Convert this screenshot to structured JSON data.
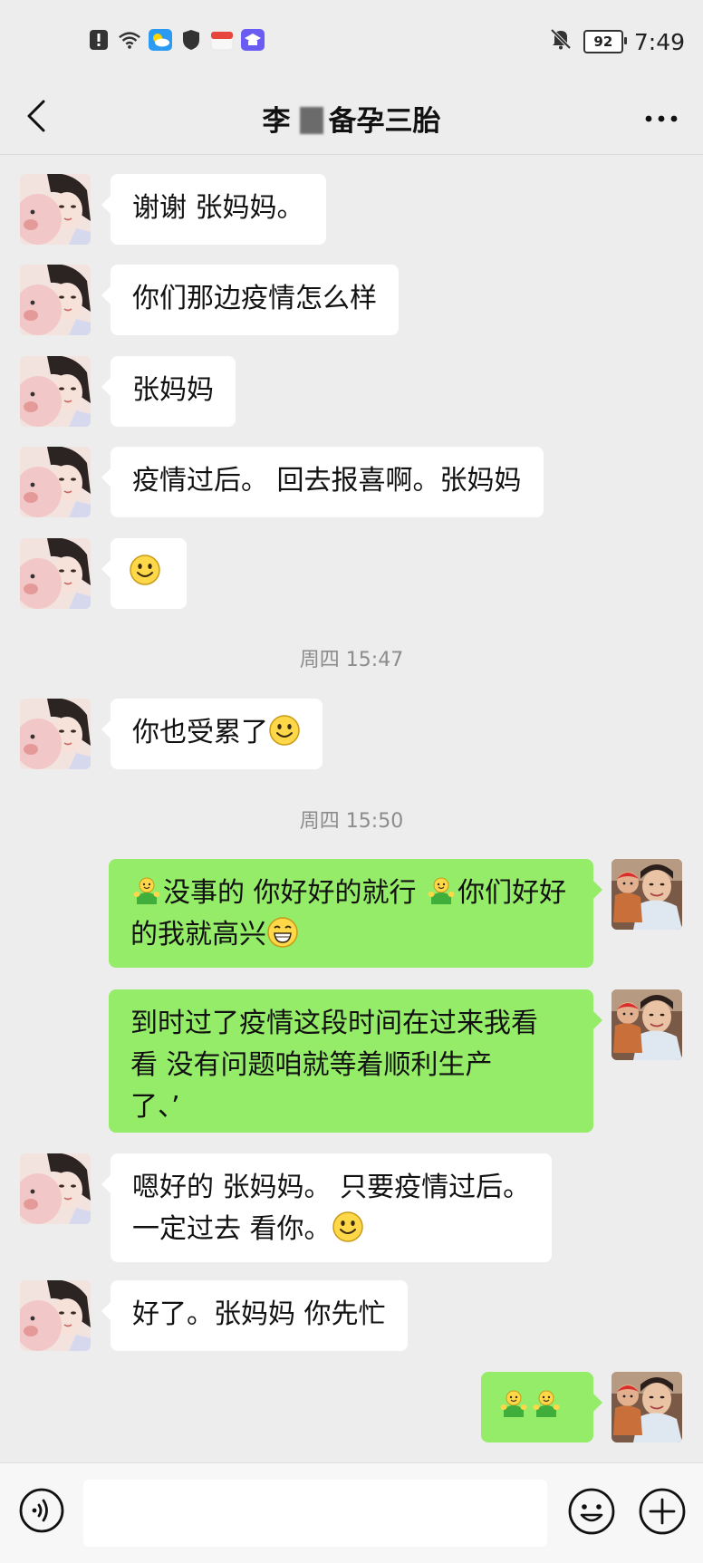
{
  "status_bar": {
    "battery_level": "92",
    "time": "7:49",
    "icons": [
      "alert-icon",
      "wifi-icon",
      "weather-app-icon",
      "shield-icon",
      "gift-app-icon",
      "education-app-icon",
      "mute-bell-icon",
      "battery-icon"
    ]
  },
  "header": {
    "title_prefix": "李",
    "title_suffix": "备孕三胎",
    "back_icon": "chevron-left-icon",
    "more_icon": "more-dots-icon"
  },
  "messages": [
    {
      "from": "contact",
      "text": "谢谢 张妈妈。"
    },
    {
      "from": "contact",
      "text": "你们那边疫情怎么样"
    },
    {
      "from": "contact",
      "text": "张妈妈"
    },
    {
      "from": "contact",
      "text": "疫情过后。 回去报喜啊。张妈妈"
    },
    {
      "from": "contact",
      "emoji": "smile-emoji"
    },
    {
      "timestamp": "周四 15:47"
    },
    {
      "from": "contact",
      "text": "你也受累了",
      "emoji": "smile-emoji"
    },
    {
      "timestamp": "周四 15:50"
    },
    {
      "from": "me",
      "part1": "没事的 你好好的就行 ",
      "part2": "你们好好的我就高兴",
      "emojis": [
        "hug-emoji",
        "hug-emoji",
        "grin-emoji"
      ]
    },
    {
      "from": "me",
      "line1": "到时过了疫情这段时间在过来我看",
      "line2": "看 没有问题咱就等着顺利生产",
      "line3": "了、’"
    },
    {
      "from": "contact",
      "line1": "嗯好的 张妈妈。 只要疫情过后。",
      "line2": "一定过去 看你。",
      "emoji": "smile-emoji"
    },
    {
      "from": "contact",
      "text": "好了。张妈妈 你先忙"
    },
    {
      "from": "me",
      "emojis": [
        "hug-emoji",
        "hug-emoji"
      ]
    }
  ],
  "input_bar": {
    "voice_icon": "voice-icon",
    "input_value": "",
    "emoji_icon": "emoji-icon",
    "plus_icon": "plus-icon"
  },
  "colors": {
    "background": "#ededed",
    "outgoing_bubble": "#95ec69",
    "incoming_bubble": "#ffffff",
    "timestamp_text": "#8c8c8c"
  }
}
